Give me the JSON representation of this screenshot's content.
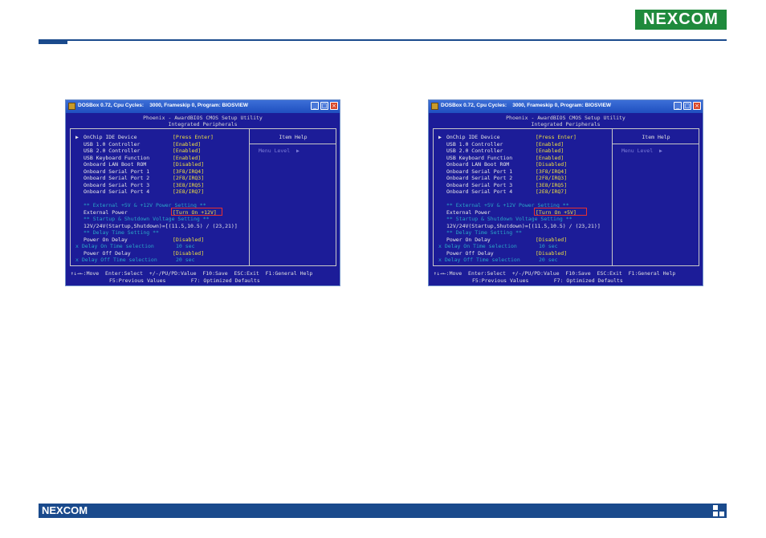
{
  "header": {
    "logo": "NEXCOM"
  },
  "footer": {
    "logo": "NEXCOM"
  },
  "windows": [
    {
      "title_bar": "DOSBox 0.72, Cpu Cycles:    3000, Frameskip 0, Program: BIOSVIEW",
      "bios_title": "Phoenix - AwardBIOS CMOS Setup Utility",
      "bios_subtitle": "Integrated Peripherals",
      "item_help": "Item Help",
      "menu_level": "Menu Level",
      "rows": [
        {
          "label": "OnChip IDE Device",
          "value": "[Press Enter]",
          "pointer": "▶"
        },
        {
          "label": "USB 1.0 Controller",
          "value": "[Enabled]"
        },
        {
          "label": "USB 2.0 Controller",
          "value": "[Enabled]"
        },
        {
          "label": "USB Keyboard Function",
          "value": "[Enabled]"
        },
        {
          "label": "Onboard LAN Boot ROM",
          "value": "[Disabled]"
        },
        {
          "label": "Onboard Serial Port 1",
          "value": "[3F8/IRQ4]"
        },
        {
          "label": "Onboard Serial Port 2",
          "value": "[2F8/IRQ3]"
        },
        {
          "label": "Onboard Serial Port 3",
          "value": "[3E8/IRQ5]"
        },
        {
          "label": "Onboard Serial Port 4",
          "value": "[2E8/IRQ7]"
        }
      ],
      "sec_power": "** External +5V & +12V Power Setting **",
      "ext_power_label": "External Power",
      "ext_power_value": "[Turn On +12V]",
      "sec_voltage": "** Startup & Shutdown Voltage Setting **",
      "voltage_line": "12V/24V(Startup,Shutdown)=[(11.5,10.5) / (23,21)]",
      "sec_delay": "** Delay Time Setting **",
      "pon_label": "Power On Delay",
      "pon_value": "[Disabled]",
      "don_label": "x Delay On Time selection",
      "don_value": "10 sec",
      "poff_label": "Power Off Delay",
      "poff_value": "[Disabled]",
      "doff_label": "x Delay Off Time selection",
      "doff_value": "20 sec",
      "status1": "↑↓→←:Move  Enter:Select  +/-/PU/PD:Value  F10:Save  ESC:Exit  F1:General Help",
      "status2": "F5:Previous Values        F7: Optimized Defaults"
    },
    {
      "title_bar": "DOSBox 0.72, Cpu Cycles:    3000, Frameskip 0, Program: BIOSVIEW",
      "bios_title": "Phoenix - AwardBIOS CMOS Setup Utility",
      "bios_subtitle": "Integrated Peripherals",
      "item_help": "Item Help",
      "menu_level": "Menu Level",
      "rows": [
        {
          "label": "OnChip IDE Device",
          "value": "[Press Enter]",
          "pointer": "▶"
        },
        {
          "label": "USB 1.0 Controller",
          "value": "[Enabled]"
        },
        {
          "label": "USB 2.0 Controller",
          "value": "[Enabled]"
        },
        {
          "label": "USB Keyboard Function",
          "value": "[Enabled]"
        },
        {
          "label": "Onboard LAN Boot ROM",
          "value": "[Disabled]"
        },
        {
          "label": "Onboard Serial Port 1",
          "value": "[3F8/IRQ4]"
        },
        {
          "label": "Onboard Serial Port 2",
          "value": "[2F8/IRQ3]"
        },
        {
          "label": "Onboard Serial Port 3",
          "value": "[3E8/IRQ5]"
        },
        {
          "label": "Onboard Serial Port 4",
          "value": "[2E8/IRQ7]"
        }
      ],
      "sec_power": "** External +5V & +12V Power Setting **",
      "ext_power_label": "External Power",
      "ext_power_value": "[Turn On +5V]",
      "sec_voltage": "** Startup & Shutdown Voltage Setting **",
      "voltage_line": "12V/24V(Startup,Shutdown)=[(11.5,10.5) / (23,21)]",
      "sec_delay": "** Delay Time Setting **",
      "pon_label": "Power On Delay",
      "pon_value": "[Disabled]",
      "don_label": "x Delay On Time selection",
      "don_value": "10 sec",
      "poff_label": "Power Off Delay",
      "poff_value": "[Disabled]",
      "doff_label": "x Delay Off Time selection",
      "doff_value": "20 sec",
      "status1": "↑↓→←:Move  Enter:Select  +/-/PU/PD:Value  F10:Save  ESC:Exit  F1:General Help",
      "status2": "F5:Previous Values        F7: Optimized Defaults"
    }
  ]
}
